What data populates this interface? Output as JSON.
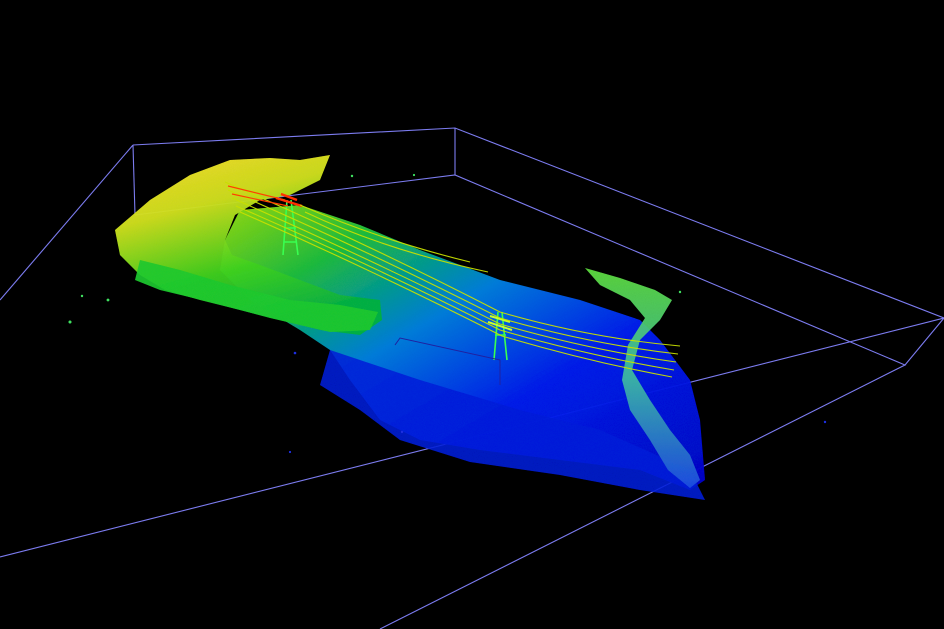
{
  "scene": {
    "background_color": "#000000",
    "bounding_box_color": "#8a8aff",
    "height_colormap": [
      "#0a10e6",
      "#0050ff",
      "#00a0d0",
      "#10c040",
      "#7fe000",
      "#e8e000",
      "#ff8000",
      "#ff2000"
    ],
    "power_line_color": "#c8e000",
    "tower_color": "#40ff40",
    "tower_top_color": "#ff3000"
  }
}
